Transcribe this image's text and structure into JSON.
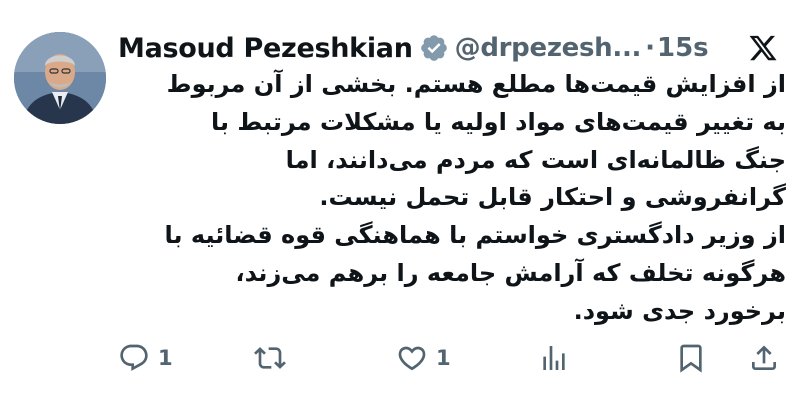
{
  "author": {
    "name": "Masoud Pezeshkian",
    "handle": "@drpezesh...",
    "separator": "·",
    "timestamp": "15s",
    "verified_badge_color": "#829aab"
  },
  "tweet": {
    "lines": [
      "از افزایش قیمت‌ها مطلع هستم. بخشی از آن مربوط",
      "به تغییر قیمت‌های مواد اولیه یا مشکلات مرتبط با",
      "جنگ ظالمانه‌ای است که مردم می‌دانند، اما",
      "گرانفروشی و احتکار قابل تحمل نیست.",
      "از وزیر دادگستری خواستم با هماهنگی قوه قضائیه با",
      "هرگونه تخلف که آرامش جامعه را برهم می‌زند،",
      "برخورد جدی شود."
    ]
  },
  "actions": {
    "reply": {
      "icon": "reply-icon",
      "count": "1"
    },
    "repost": {
      "icon": "repost-icon"
    },
    "like": {
      "icon": "heart-icon",
      "count": "1"
    },
    "views": {
      "icon": "views-icon"
    },
    "bookmark": {
      "icon": "bookmark-icon"
    },
    "share": {
      "icon": "share-icon"
    }
  },
  "icons": {
    "platform_logo": "x-logo-icon"
  },
  "colors": {
    "text": "#0f1419",
    "secondary": "#536471",
    "background": "#ffffff"
  }
}
